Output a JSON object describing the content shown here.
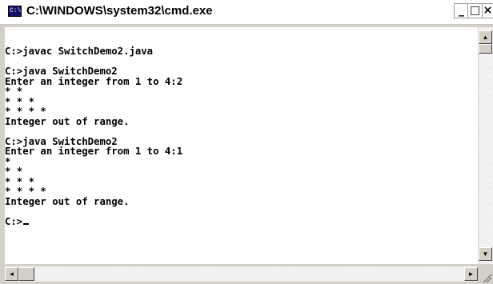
{
  "window": {
    "title": "C:\\WINDOWS\\system32\\cmd.exe",
    "icon": "cmd-icon",
    "icon_text": "C:\\",
    "controls": {
      "minimize": "_",
      "maximize": "□",
      "close": "×"
    }
  },
  "console": {
    "lines": [
      "C:>javac SwitchDemo2.java",
      "",
      "C:>java SwitchDemo2",
      "Enter an integer from 1 to 4:2",
      "* *",
      "* * *",
      "* * * *",
      "Integer out of range.",
      "",
      "C:>java SwitchDemo2",
      "Enter an integer from 1 to 4:1",
      "*",
      "* *",
      "* * *",
      "* * * *",
      "Integer out of range.",
      "",
      "C:>"
    ]
  },
  "scrollbars": {
    "up_arrow": "▲",
    "down_arrow": "▼",
    "left_arrow": "◄",
    "right_arrow": "►"
  }
}
